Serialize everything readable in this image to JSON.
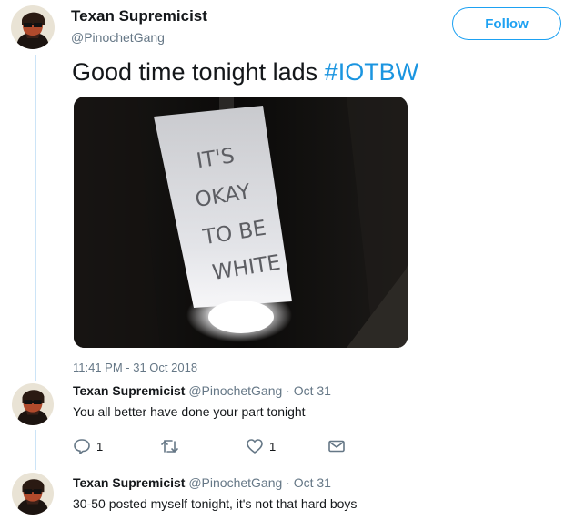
{
  "tweet": {
    "author_name": "Texan Supremicist",
    "author_handle": "@PinochetGang",
    "follow_label": "Follow",
    "text": "Good time tonight lads ",
    "hashtag": "#IOTBW",
    "media_sign_lines": [
      "IT'S",
      "OKAY",
      "TO BE",
      "WHITE"
    ],
    "timestamp": "11:41 PM - 31 Oct 2018"
  },
  "replies": [
    {
      "author_name": "Texan Supremicist",
      "meta": "@PinochetGang · Oct 31",
      "text": "You all better have done your part tonight",
      "actions": {
        "reply_count": "1",
        "retweet_count": "",
        "like_count": "1"
      }
    },
    {
      "author_name": "Texan Supremicist",
      "meta": "@PinochetGang · Oct 31",
      "text": "30-50 posted myself tonight, it's not that hard boys"
    }
  ],
  "icons": {
    "reply": "reply-icon",
    "retweet": "retweet-icon",
    "like": "heart-icon",
    "dm": "envelope-icon"
  },
  "colors": {
    "accent": "#1da1f2",
    "hashtag": "#1b95e0",
    "muted": "#657786",
    "thread_line": "#cce4f7"
  }
}
